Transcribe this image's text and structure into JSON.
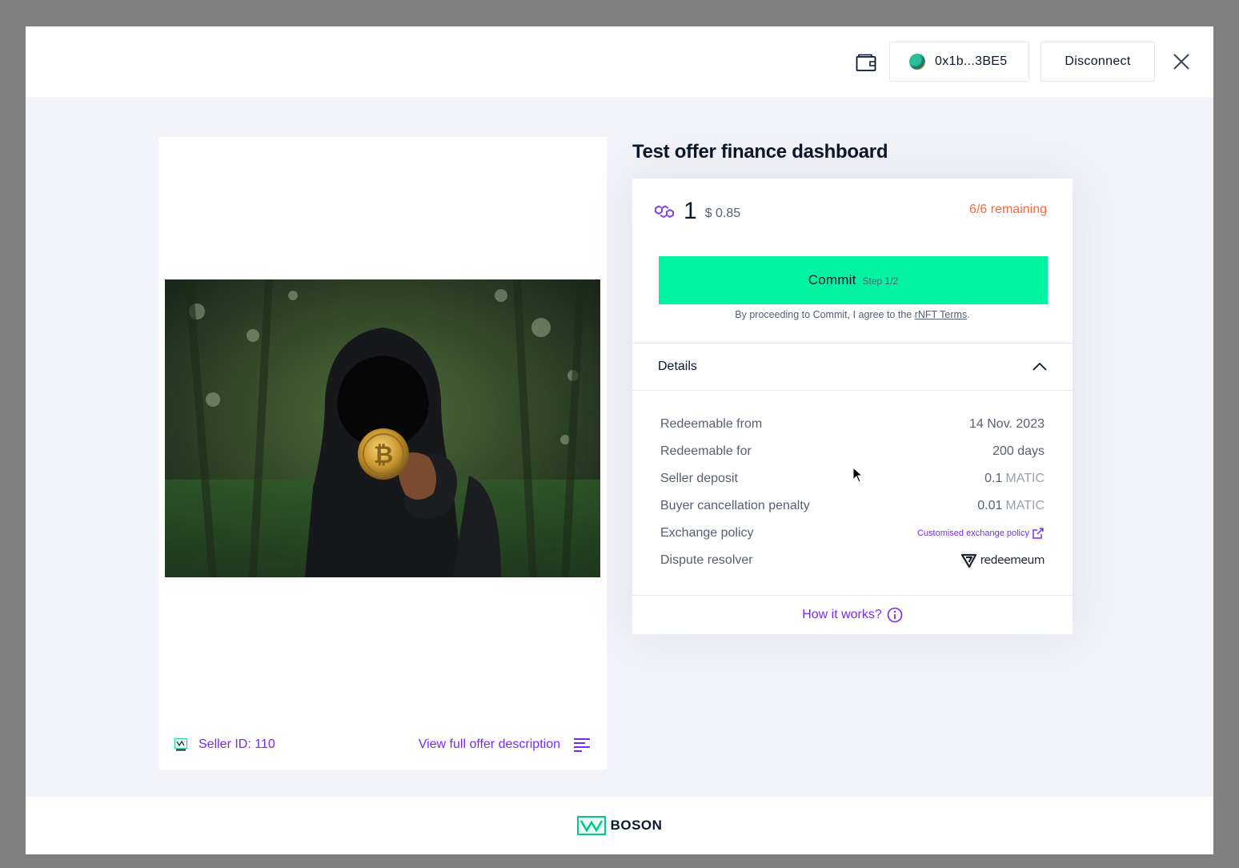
{
  "topbar": {
    "wallet_icon": "wallet-icon",
    "address": "0x1b...3BE5",
    "disconnect_label": "Disconnect",
    "close_icon": "close-icon"
  },
  "product": {
    "image_alt": "Hooded figure holding a bitcoin coin in a forest",
    "seller_label": "Seller ID: 110",
    "view_description_label": "View full offer description"
  },
  "offer": {
    "title": "Test offer finance dashboard",
    "currency_icon": "polygon-icon",
    "price": "1",
    "price_usd": "$ 0.85",
    "remaining": "6/6 remaining",
    "commit_label": "Commit",
    "commit_step": "Step 1/2",
    "terms_prefix": "By proceeding to Commit, I agree to the ",
    "terms_link": "rNFT Terms",
    "terms_suffix": ".",
    "details_label": "Details",
    "details": {
      "redeemable_from_key": "Redeemable from",
      "redeemable_from_value": "14 Nov. 2023",
      "redeemable_for_key": "Redeemable for",
      "redeemable_for_value": "200 days",
      "seller_deposit_key": "Seller deposit",
      "seller_deposit_value": "0.1",
      "seller_deposit_unit": "MATIC",
      "penalty_key": "Buyer cancellation penalty",
      "penalty_value": "0.01",
      "penalty_unit": "MATIC",
      "exchange_policy_key": "Exchange policy",
      "exchange_policy_value": "Customised exchange policy",
      "dispute_resolver_key": "Dispute resolver",
      "dispute_resolver_value": "redeemeum"
    },
    "how_it_works": "How it works?"
  },
  "footer": {
    "brand": "BOSON"
  },
  "colors": {
    "accent_purple": "#7829f9",
    "commit_green": "#02f3a2",
    "remaining_orange": "#fc6838",
    "text_dark": "#09182c"
  }
}
